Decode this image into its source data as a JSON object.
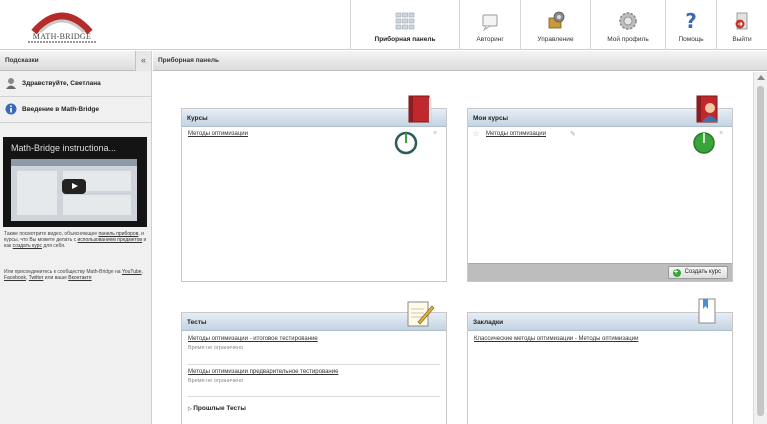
{
  "header": {
    "logo_text": "MATH-BRIDGE",
    "nav": [
      {
        "key": "dashboard",
        "label": "Приборная панель",
        "icon": "dashboard-grid-icon",
        "active": true
      },
      {
        "key": "author",
        "label": "Авторинг",
        "icon": "authoring-icon",
        "active": false
      },
      {
        "key": "management",
        "label": "Управление",
        "icon": "management-icon",
        "active": false
      },
      {
        "key": "profile",
        "label": "Мой профиль",
        "icon": "profile-gear-icon",
        "active": false
      },
      {
        "key": "help",
        "label": "Помощь",
        "icon": "help-icon",
        "active": false
      },
      {
        "key": "logout",
        "label": "Выйти",
        "icon": "logout-icon",
        "active": false
      }
    ]
  },
  "sidebar": {
    "title": "Подсказки",
    "collapse": "«",
    "greeting": "Здравствуйте, Светлана",
    "intro": "Введение в Math-Bridge",
    "video_title": "Math-Bridge instructiona...",
    "note1": {
      "t1": "Также посмотрите видео, объясняющее",
      "l1": "панель приборов",
      "t2": ", и курсы, что Вы можете делать с",
      "l2": "использованием предметов",
      "t3": " и как",
      "l3": "создать курс",
      "t4": " для себя."
    },
    "note2": {
      "t1": "Или присоединитесь к сообществу Math-Bridge на ",
      "l1": "YouTube",
      "sep1": ", ",
      "l2": "Facebook",
      "sep2": ", ",
      "l3": "Twitter",
      "t2": " или ваше ",
      "l4": "Вконтакте"
    }
  },
  "main": {
    "header_title": "Приборная панель",
    "panels": {
      "courses": {
        "title": "Курсы",
        "link": "Методы оптимизации",
        "icon": "book-icon"
      },
      "my_courses": {
        "title": "Мои курсы",
        "link": "Методы оптимизации",
        "icon": "book-user-icon",
        "create_button": "Создать курс"
      },
      "tests": {
        "title": "Тесты",
        "items": [
          {
            "link": "Методы оптимизации - итоговое тестирование",
            "sub": "Время не ограничено"
          },
          {
            "link": "Методы оптимизации предварительное тестирование",
            "sub": "Время не ограничено"
          }
        ],
        "past": "Прошлые Тесты",
        "icon": "notepad-pencil-icon"
      },
      "bookmarks": {
        "title": "Закладки",
        "link": "Классические методы оптимизации - Методы оптимизации",
        "icon": "bookmark-page-icon"
      }
    }
  },
  "colors": {
    "accent_red": "#b52a2a",
    "panel_header": "#c4d3e2",
    "progress_green": "#3aa33a",
    "progress_dark": "#2d5a5a"
  }
}
